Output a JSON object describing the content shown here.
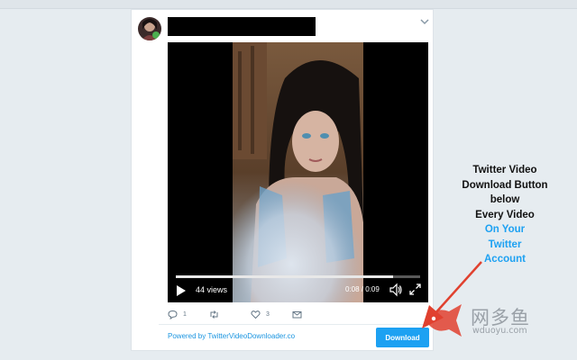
{
  "tweet": {
    "video": {
      "views_label": "44 views",
      "time_label": "0:08 / 0:09",
      "progress_fraction": 0.89
    },
    "actions": {
      "reply_count": "1",
      "retweet_count": "",
      "like_count": "3"
    },
    "powered_by_label": "Powered by TwitterVideoDownloader.co",
    "download_label": "Download"
  },
  "callout": {
    "line1": "Twitter Video",
    "line2": "Download Button",
    "line3": "below",
    "line4": "Every Video",
    "line5": "On Your",
    "line6": "Twitter",
    "line7": "Account"
  },
  "watermark": {
    "brand_cn": "网多鱼",
    "url": "wduoyu.com"
  },
  "icons": {
    "avatar": "avatar-photo",
    "caret": "chevron-down-icon",
    "play": "play-icon",
    "volume": "volume-icon",
    "fullscreen": "fullscreen-icon",
    "reply": "reply-icon",
    "retweet": "retweet-icon",
    "like": "heart-icon",
    "message": "envelope-icon"
  },
  "colors": {
    "brand_blue": "#1da1f2",
    "link_blue": "#1b95e0",
    "annotation_red": "#e0412f",
    "background": "#e6ecf0"
  }
}
